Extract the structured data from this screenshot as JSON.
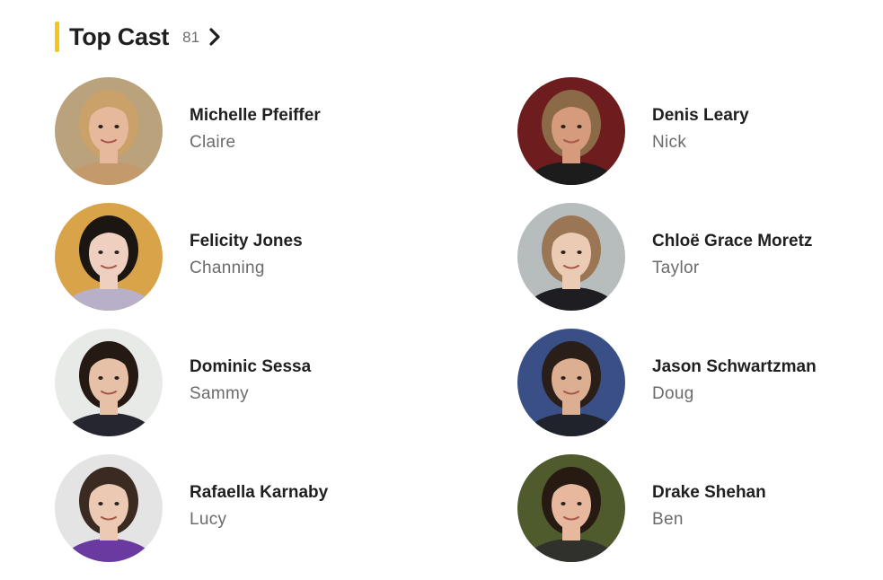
{
  "section": {
    "title": "Top Cast",
    "count": "81",
    "accent_color": "#f5c518",
    "chevron_icon": "chevron-right-icon"
  },
  "cast": [
    {
      "actor": "Michelle Pfeiffer",
      "character": "Claire",
      "bg": "#b9a27c",
      "skin": "#e7b99c",
      "hair": "#caa168",
      "shirt": "#c49a6c"
    },
    {
      "actor": "Denis Leary",
      "character": "Nick",
      "bg": "#6d1d1d",
      "skin": "#d69a7c",
      "hair": "#8b6a48",
      "shirt": "#1c1c1c"
    },
    {
      "actor": "Felicity Jones",
      "character": "Channing",
      "bg": "#d9a34a",
      "skin": "#efcfbf",
      "hair": "#1b1612",
      "shirt": "#b8b0c8"
    },
    {
      "actor": "Chloë Grace Moretz",
      "character": "Taylor",
      "bg": "#b7bcbd",
      "skin": "#eccbb4",
      "hair": "#9a7655",
      "shirt": "#1e1e22"
    },
    {
      "actor": "Dominic Sessa",
      "character": "Sammy",
      "bg": "#e8eae8",
      "skin": "#e6c1a8",
      "hair": "#251913",
      "shirt": "#262630"
    },
    {
      "actor": "Jason Schwartzman",
      "character": "Doug",
      "bg": "#3a4f86",
      "skin": "#dcae92",
      "hair": "#2a1e18",
      "shirt": "#20232c"
    },
    {
      "actor": "Rafaella Karnaby",
      "character": "Lucy",
      "bg": "#e4e4e4",
      "skin": "#ecc9b2",
      "hair": "#3b2a22",
      "shirt": "#6a3aa0"
    },
    {
      "actor": "Drake Shehan",
      "character": "Ben",
      "bg": "#4f5a2d",
      "skin": "#e7b89d",
      "hair": "#261a13",
      "shirt": "#30312d"
    }
  ]
}
